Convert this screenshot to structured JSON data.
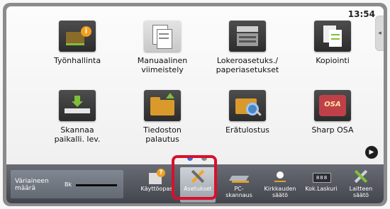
{
  "status": {
    "time": "13:54"
  },
  "home_tiles": [
    {
      "label": "Työnhallinta",
      "icon": "job-status-icon"
    },
    {
      "label": "Manuaalinen\nviimeistely",
      "icon": "manual-finishing-icon"
    },
    {
      "label": "Lokeroasetuks./\npaperiasetukset",
      "icon": "tray-settings-icon"
    },
    {
      "label": "Kopiointi",
      "icon": "copy-icon"
    },
    {
      "label": "Skannaa\npaikalli. lev.",
      "icon": "scan-local-drive-icon"
    },
    {
      "label": "Tiedoston\npalautus",
      "icon": "file-retrieve-icon"
    },
    {
      "label": "Erätulostus",
      "icon": "batch-print-icon"
    },
    {
      "label": "Sharp OSA",
      "icon": "sharp-osa-icon"
    }
  ],
  "pager": {
    "active": 0,
    "count": 2
  },
  "toner": {
    "label": "Väriaineen\nmäärä",
    "color_label": "Bk",
    "level": 1.0
  },
  "bottom_buttons": [
    {
      "label": "Käyttöopas",
      "icon": "manual-icon"
    },
    {
      "label": "Asetukset",
      "icon": "settings-icon",
      "highlighted": true
    },
    {
      "label": "PC-skannaus",
      "icon": "pc-scan-icon"
    },
    {
      "label": "Kirkkauden\nsäätö",
      "icon": "brightness-icon"
    },
    {
      "label": "Kok.Laskuri",
      "icon": "total-count-icon"
    },
    {
      "label": "Laitteen säätö",
      "icon": "device-settings-icon"
    }
  ],
  "colors": {
    "highlight": "#d8102d",
    "dot_active": "#2f6fd8",
    "dot_inactive": "#8a8a8a"
  }
}
